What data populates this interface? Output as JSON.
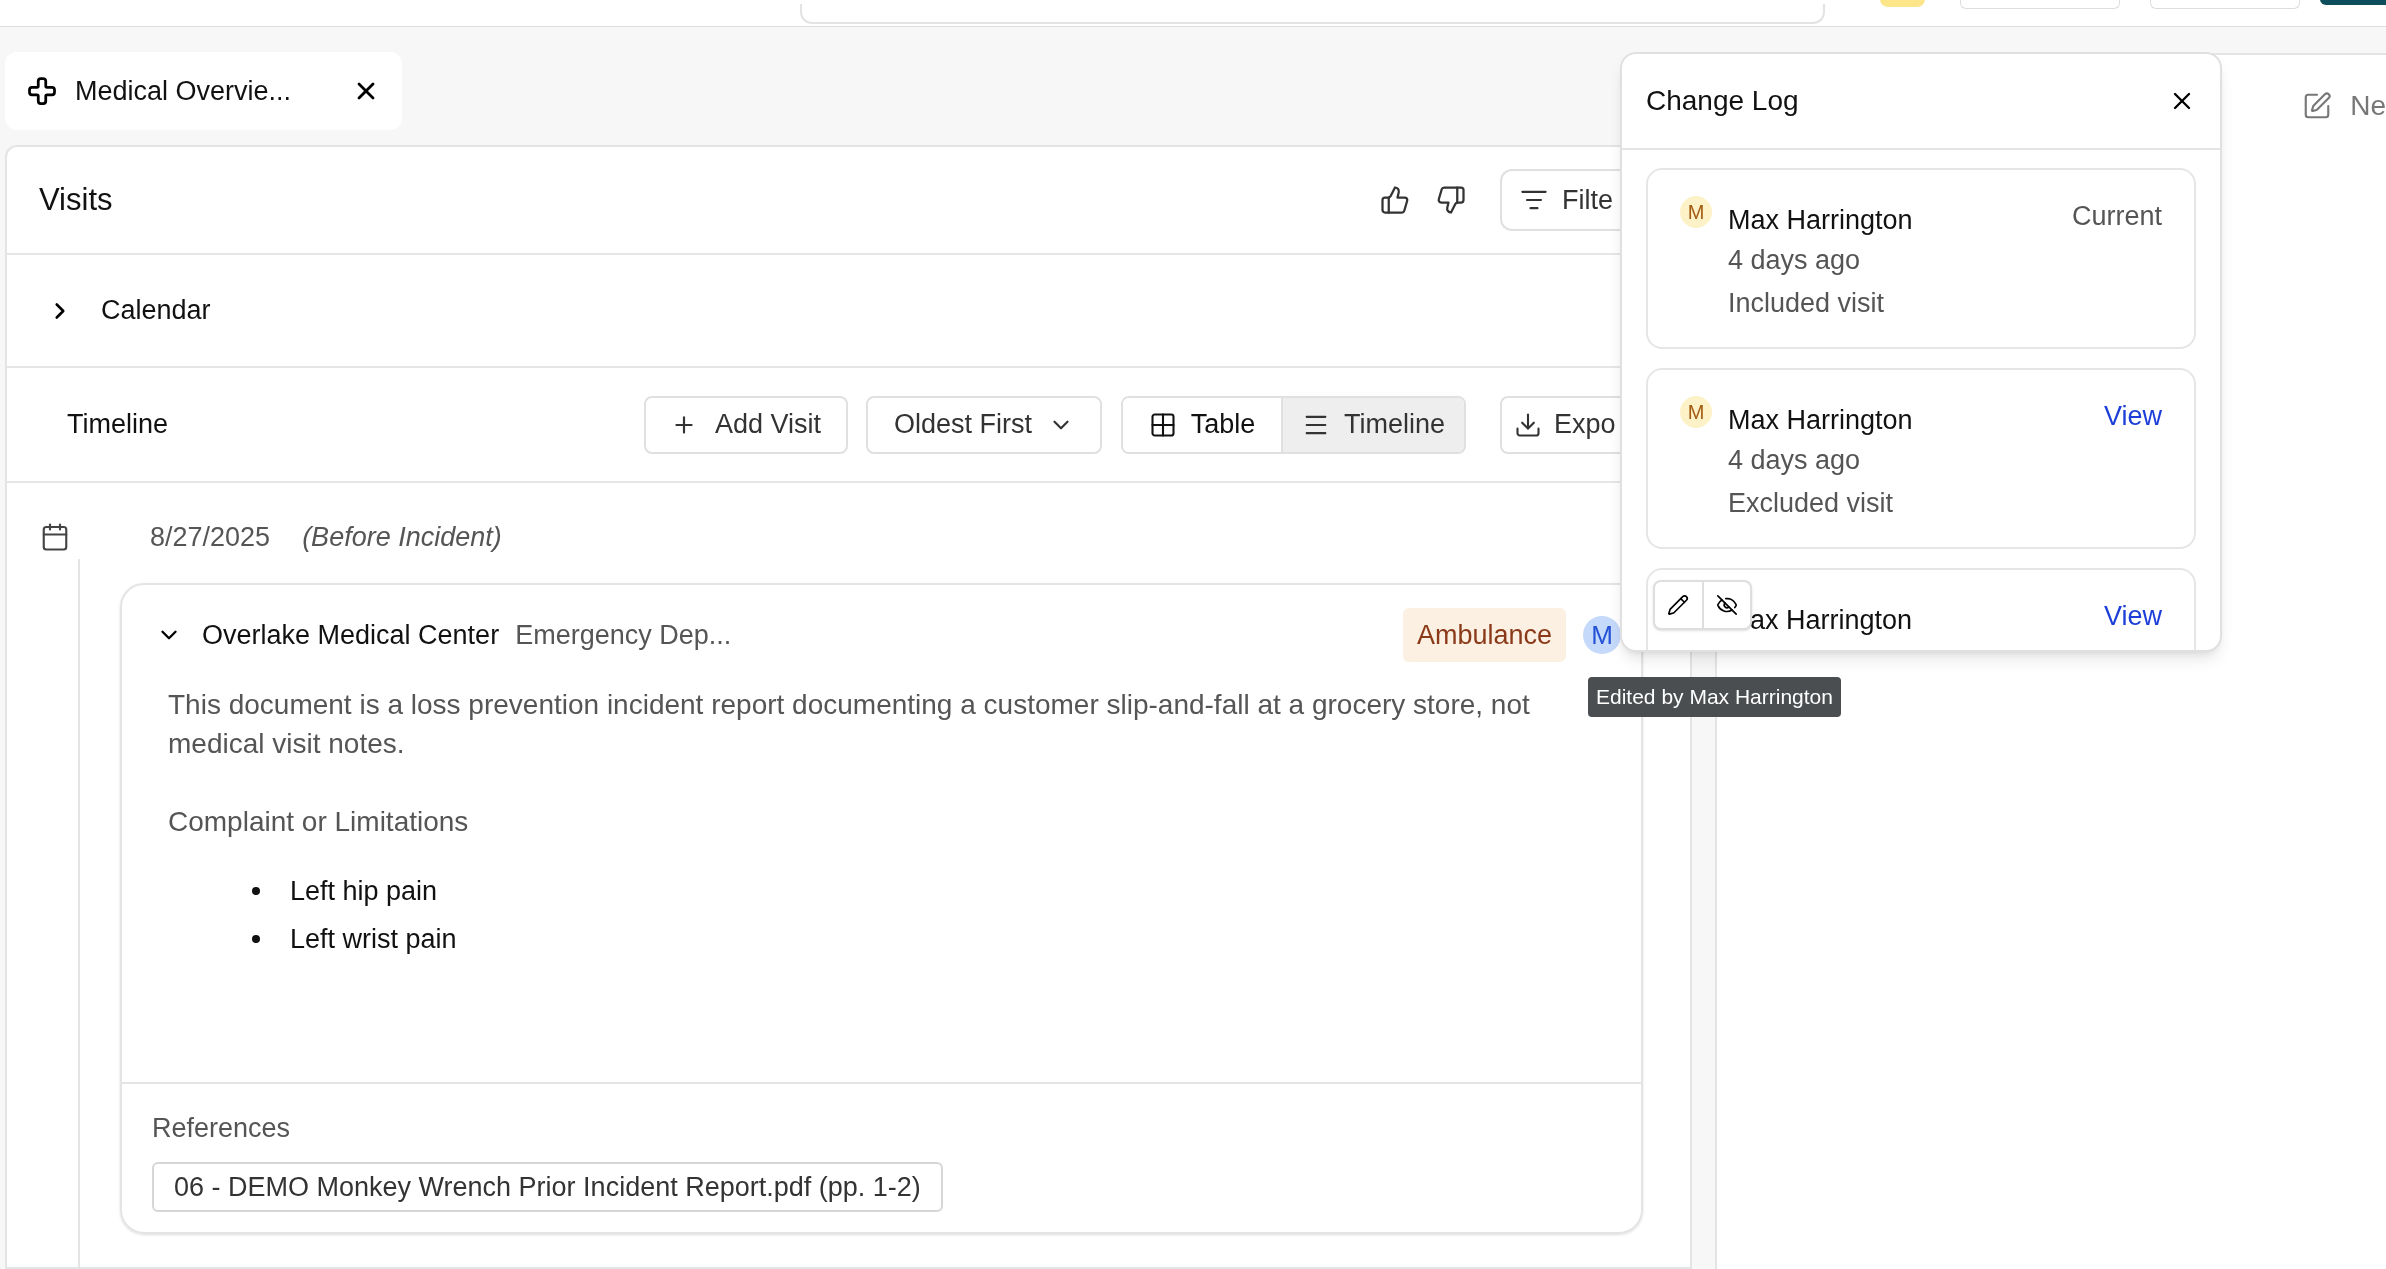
{
  "tabs": [
    {
      "label": "Medical Overvie...",
      "selected": true
    }
  ],
  "visits": {
    "title": "Visits",
    "filter_button": "Filte"
  },
  "calendar": {
    "label": "Calendar",
    "expanded": false
  },
  "timeline_toolbar": {
    "title": "Timeline",
    "add_button": "Add Visit",
    "sort": "Oldest First",
    "export_button": "Expo",
    "views": [
      {
        "label": "Table",
        "selected": false
      },
      {
        "label": "Timeline",
        "selected": true
      }
    ]
  },
  "entries": [
    {
      "date": "8/27/2025",
      "note": "(Before Incident)",
      "visit": {
        "provider": "Overlake Medical Center",
        "department": "Emergency Dep...",
        "expanded": true,
        "badge": "Ambulance",
        "avatar": "M",
        "summary": "This document is a loss prevention incident report documenting a customer slip-and-fall at a grocery store, not medical visit notes.",
        "section_title": "Complaint or Limitations",
        "items": [
          "Left hip pain",
          "Left wrist pain"
        ],
        "references_label": "References",
        "references": [
          "06 - DEMO Monkey Wrench Prior Incident Report.pdf (pp. 1-2)"
        ]
      }
    }
  ],
  "side_panel": {
    "new_button": "Ne"
  },
  "change_log": {
    "title": "Change Log",
    "entries": [
      {
        "avatar": "M",
        "name": "Max Harrington",
        "time": "4 days ago",
        "action": "Included visit",
        "status": "Current",
        "kind": "current"
      },
      {
        "avatar": "M",
        "name": "Max Harrington",
        "time": "4 days ago",
        "action": "Excluded visit",
        "status": "View",
        "kind": "link"
      },
      {
        "name": "ax Harrington",
        "status": "View",
        "kind": "link"
      }
    ]
  },
  "tooltip": "Edited by Max Harrington"
}
